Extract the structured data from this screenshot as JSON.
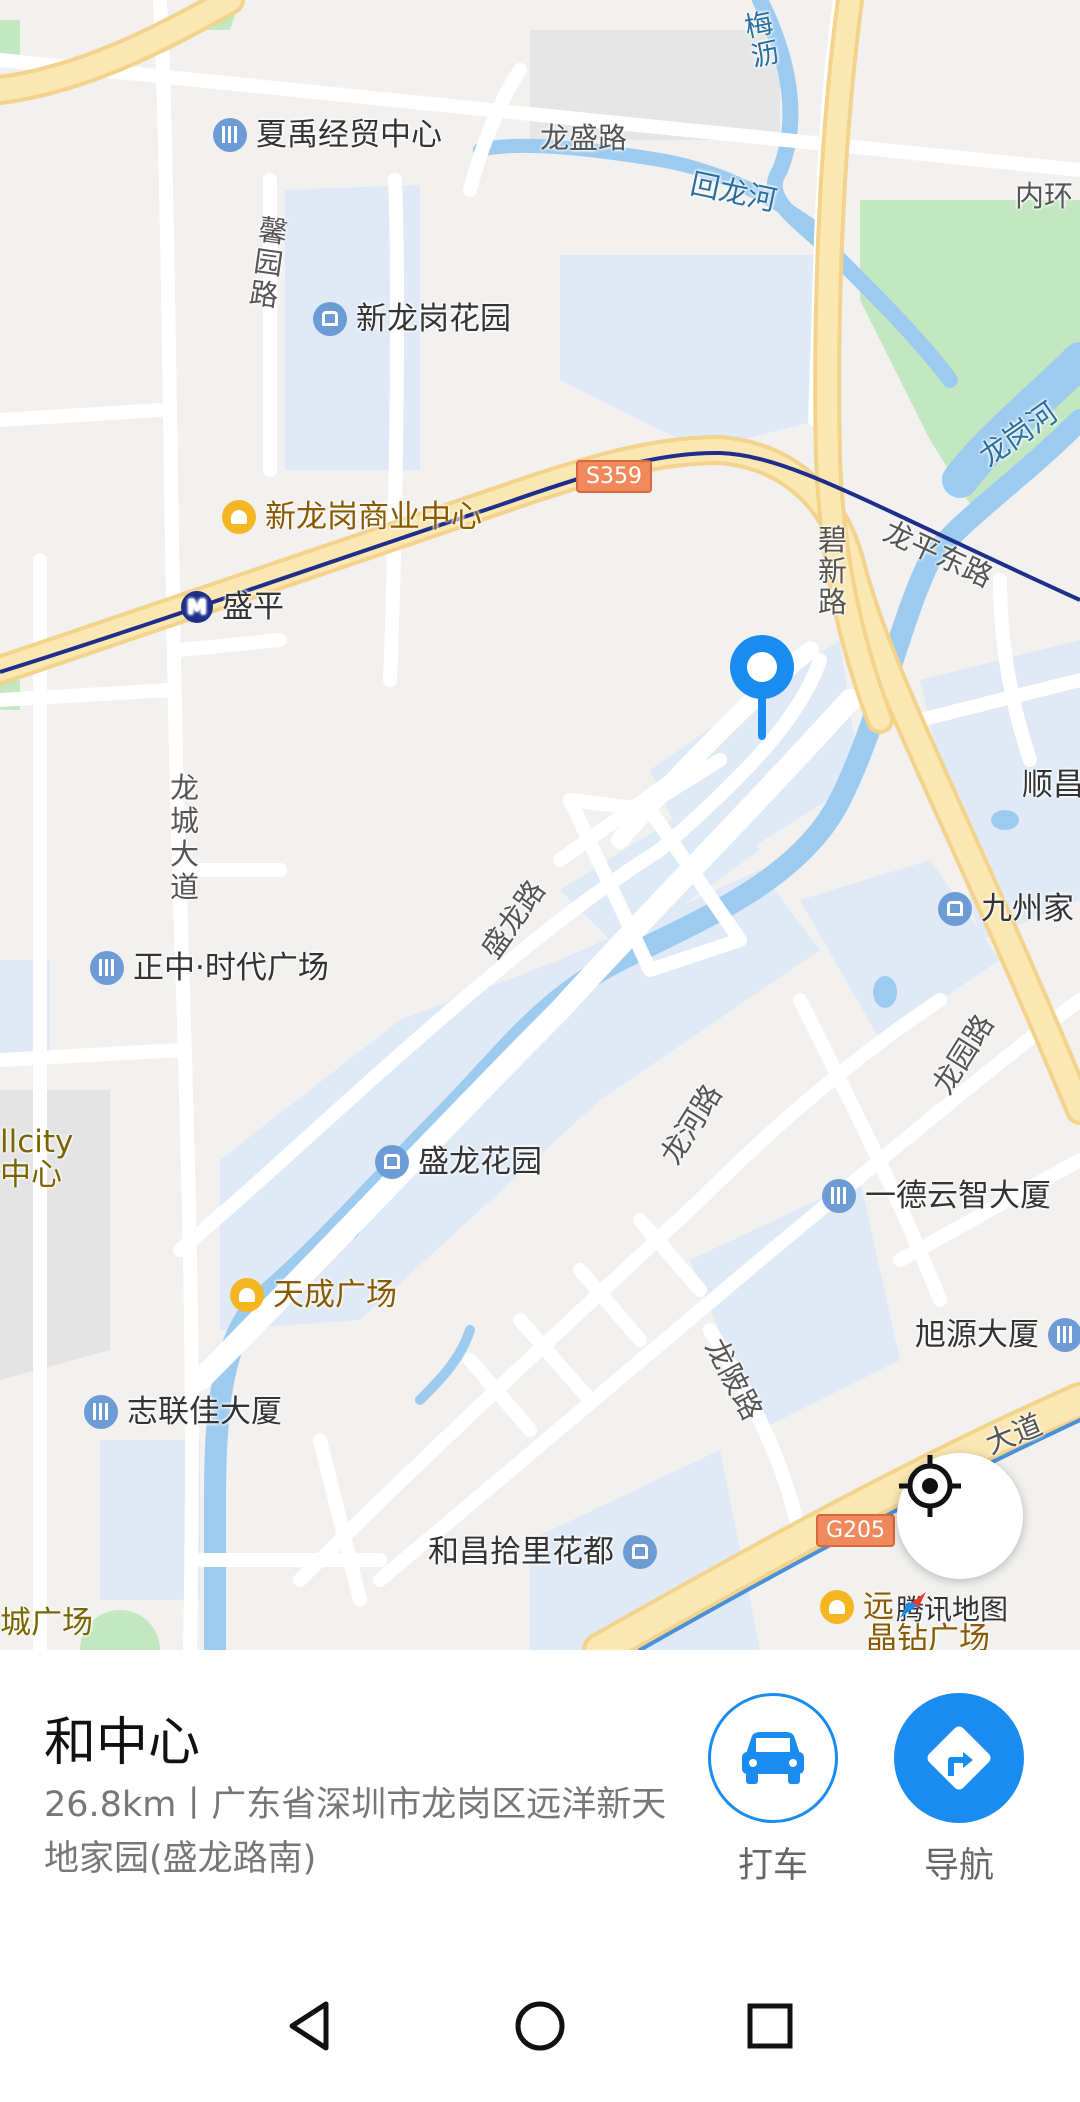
{
  "map": {
    "labels": {
      "xiayu": "夏禹经贸中心",
      "longsheng_rd": "龙盛路",
      "huilong_river": "回龙河",
      "neihuan": "内环",
      "meisha": "梅沥",
      "xinyuan_rd": "馨园路",
      "xinlonggang_garden": "新龙岗花园",
      "longgang_river": "龙岗河",
      "xinlonggang_center": "新龙岗商业中心",
      "shengping": "盛平",
      "bixin_rd": "碧新路",
      "longping_east_rd": "龙平东路",
      "shunchang": "顺昌",
      "longcheng_ave": "龙城大道",
      "shenglong_rd": "盛龙路",
      "jiuzhou": "九州家",
      "zhengzhong": "正中·时代广场",
      "longyuan_rd": "龙园路",
      "longhe_rd": "龙河路",
      "allcity_1": "llcity",
      "allcity_2": "中心",
      "shenglong_garden": "盛龙花园",
      "yide": "一德云智大厦",
      "tiancheng": "天成广场",
      "xuyuan": "旭源大厦",
      "longling_rd": "龙陂路",
      "zhilianjia": "志联佳大厦",
      "ave_right": "大道",
      "hechang": "和昌拾里花都",
      "left_plaza": "城广场",
      "yuan_1": "远",
      "yuan_2": "晶钻广场"
    },
    "highways": {
      "s359": "S359",
      "g205": "G205"
    },
    "brand": "腾讯地图",
    "colors": {
      "water": "#9dcbf0",
      "residential": "#dfeaf6",
      "green": "#c3e8c1",
      "highway": "#fbe7b1",
      "metro": "#1e2e8a",
      "accent": "#1a8cf0"
    }
  },
  "place": {
    "title": "和中心",
    "address": "26.8km丨广东省深圳市龙岗区远洋新天地家园(盛龙路南)"
  },
  "actions": {
    "taxi": "打车",
    "navigate": "导航"
  },
  "icons": {
    "locate": "locate-icon",
    "taxi": "car-icon",
    "navigate": "turn-arrow-icon",
    "back": "back-triangle-icon",
    "home": "home-circle-icon",
    "recents": "recents-square-icon"
  }
}
